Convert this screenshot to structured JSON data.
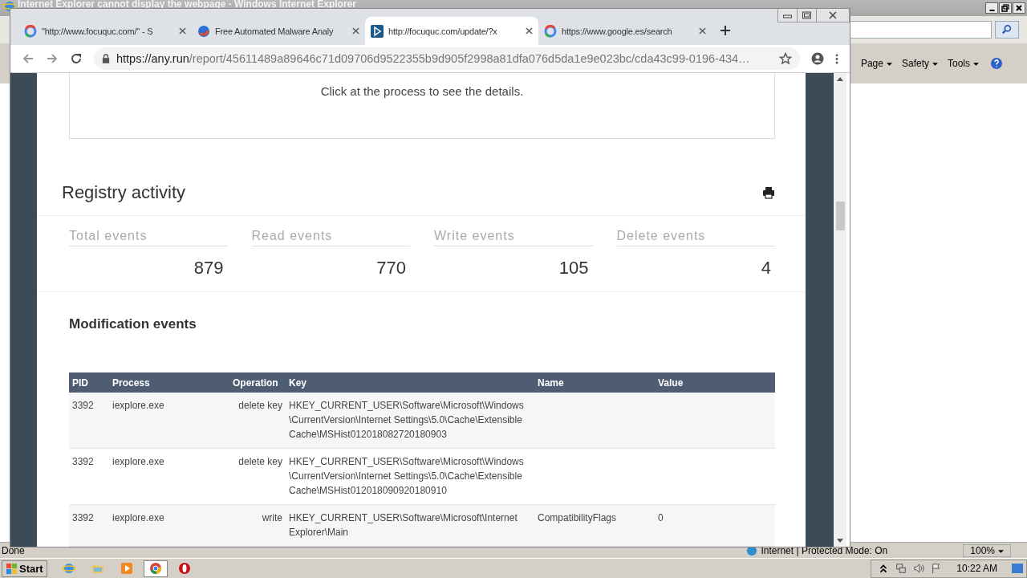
{
  "ie_window": {
    "title": "Internet Explorer cannot display the webpage - Windows Internet Explorer",
    "command_bar": [
      "Page",
      "Safety",
      "Tools"
    ],
    "status_text": "Done",
    "zone": "Internet | Protected Mode: On",
    "zoom": "100%"
  },
  "browser": {
    "tabs": [
      {
        "title": "\"http://www.focuquc.com/\" - S",
        "selected": false
      },
      {
        "title": "Free Automated Malware Analy",
        "selected": false
      },
      {
        "title": "http://focuquc.com/update/?x",
        "selected": true
      },
      {
        "title": "https://www.google.es/search",
        "selected": false
      }
    ],
    "url_host": "https://any.run",
    "url_path": "/report/45611489a89646c71d09706d9522355b9d905f2998a81dfa076d5da1e9e023bc/cda43c99-0196-434…"
  },
  "page": {
    "notice": "Click at the process to see the details.",
    "section_title": "Registry activity",
    "stats": [
      {
        "label": "Total events",
        "value": "879"
      },
      {
        "label": "Read events",
        "value": "770"
      },
      {
        "label": "Write events",
        "value": "105"
      },
      {
        "label": "Delete events",
        "value": "4"
      }
    ],
    "subsection": "Modification events",
    "table": {
      "columns": [
        "PID",
        "Process",
        "Operation",
        "Key",
        "Name",
        "Value"
      ],
      "rows": [
        [
          "3392",
          "iexplore.exe",
          "delete key",
          "HKEY_CURRENT_USER\\Software\\Microsoft\\Windows \\CurrentVersion\\Internet Settings\\5.0\\Cache\\Extensible Cache\\MSHist012018082720180903",
          "",
          ""
        ],
        [
          "3392",
          "iexplore.exe",
          "delete key",
          "HKEY_CURRENT_USER\\Software\\Microsoft\\Windows \\CurrentVersion\\Internet Settings\\5.0\\Cache\\Extensible Cache\\MSHist012018090920180910",
          "",
          ""
        ],
        [
          "3392",
          "iexplore.exe",
          "write",
          "HKEY_CURRENT_USER\\Software\\Microsoft\\Internet Explorer\\Main",
          "CompatibilityFlags",
          "0"
        ]
      ]
    }
  },
  "taskbar": {
    "start": "Start",
    "apps": [
      {
        "selected": false
      },
      {
        "selected": false
      },
      {
        "selected": false
      },
      {
        "selected": true
      },
      {
        "selected": false
      }
    ],
    "clock": "10:22 AM"
  }
}
